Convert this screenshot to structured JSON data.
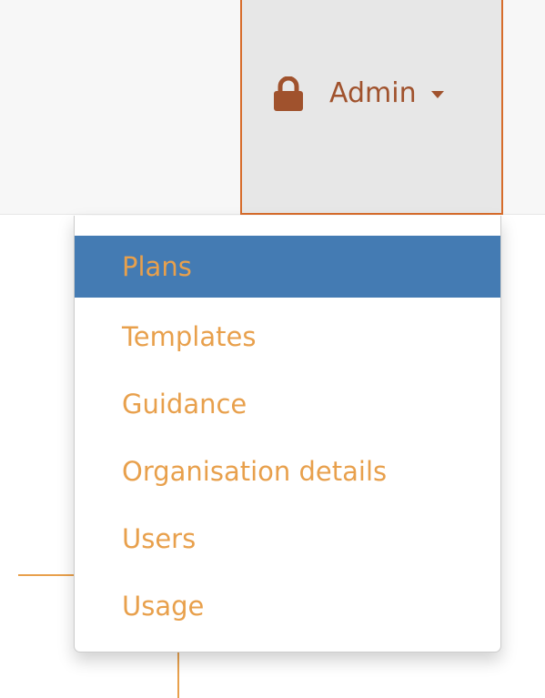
{
  "navbar": {
    "admin_menu": {
      "label": "Admin",
      "icon": "lock-icon",
      "caret_icon": "caret-down-icon"
    }
  },
  "dropdown": {
    "active_item": "Plans",
    "items": [
      {
        "label": "Plans"
      },
      {
        "label": "Templates"
      },
      {
        "label": "Guidance"
      },
      {
        "label": "Organisation details"
      },
      {
        "label": "Users"
      },
      {
        "label": "Usage"
      }
    ]
  },
  "colors": {
    "accent_orange": "#e8a04c",
    "toggle_border": "#d76c2b",
    "toggle_text": "#a0522d",
    "active_item_bg": "#447bb3",
    "navbar_bg": "#f7f7f7",
    "toggle_bg": "#e7e7e7"
  }
}
